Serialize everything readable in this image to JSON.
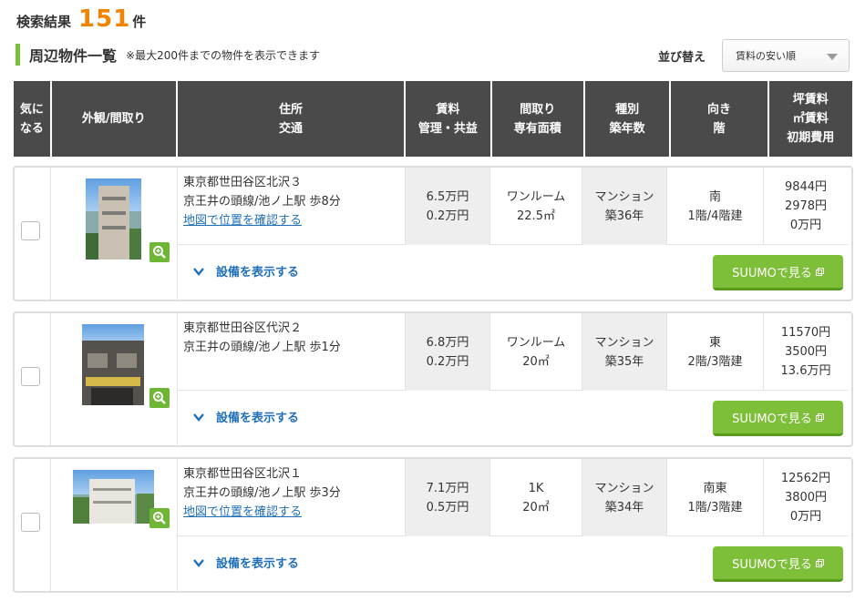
{
  "header": {
    "result_label": "検索結果",
    "result_count": "151",
    "result_unit": "件",
    "section_title": "周辺物件一覧",
    "section_note": "※最大200件までの物件を表示できます",
    "sort_label": "並び替え",
    "sort_selected": "賃料の安い順"
  },
  "columns": {
    "favorite_1": "気に",
    "favorite_2": "なる",
    "photo": "外観/間取り",
    "address_1": "住所",
    "address_2": "交通",
    "rent_1": "賃料",
    "rent_2": "管理・共益",
    "layout_1": "間取り",
    "layout_2": "専有面積",
    "type_1": "種別",
    "type_2": "築年数",
    "direction_1": "向き",
    "direction_2": "階",
    "tsubo_1": "坪賃料",
    "tsubo_2": "㎡賃料",
    "tsubo_3": "初期費用"
  },
  "listings": [
    {
      "address": "東京都世田谷区北沢３",
      "access": "京王井の頭線/池ノ上駅 歩8分",
      "map_link": "地図で位置を確認する",
      "rent": "6.5万円",
      "fee": "0.2万円",
      "layout": "ワンルーム",
      "area": "22.5㎡",
      "type": "マンション",
      "age": "築36年",
      "direction": "南",
      "floor": "1階/4階建",
      "tsubo": "9844円",
      "sqm": "2978円",
      "initial": "0万円",
      "equip_label": "設備を表示する",
      "suumo_label": "SUUMOで見る"
    },
    {
      "address": "東京都世田谷区代沢２",
      "access": "京王井の頭線/池ノ上駅 歩1分",
      "map_link": "",
      "rent": "6.8万円",
      "fee": "0.2万円",
      "layout": "ワンルーム",
      "area": "20㎡",
      "type": "マンション",
      "age": "築35年",
      "direction": "東",
      "floor": "2階/3階建",
      "tsubo": "11570円",
      "sqm": "3500円",
      "initial": "13.6万円",
      "equip_label": "設備を表示する",
      "suumo_label": "SUUMOで見る"
    },
    {
      "address": "東京都世田谷区北沢１",
      "access": "京王井の頭線/池ノ上駅 歩3分",
      "map_link": "地図で位置を確認する",
      "rent": "7.1万円",
      "fee": "0.5万円",
      "layout": "1K",
      "area": "20㎡",
      "type": "マンション",
      "age": "築34年",
      "direction": "南東",
      "floor": "1階/3階建",
      "tsubo": "12562円",
      "sqm": "3800円",
      "initial": "0万円",
      "equip_label": "設備を表示する",
      "suumo_label": "SUUMOで見る"
    }
  ],
  "colors": {
    "accent_orange": "#f08300",
    "brand_green": "#7dbf38",
    "header_dark": "#4a4a4a",
    "link_blue": "#1f6fb8"
  }
}
